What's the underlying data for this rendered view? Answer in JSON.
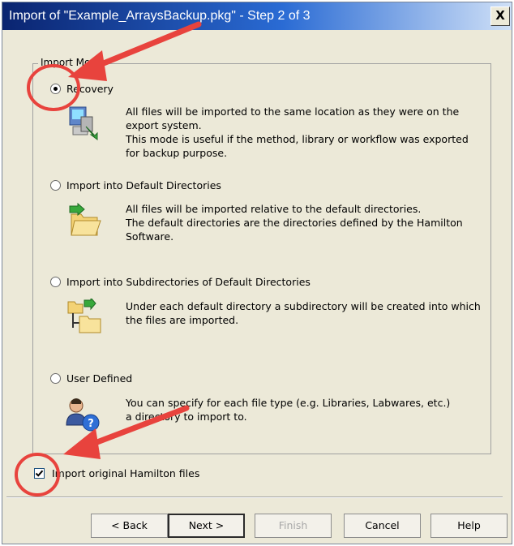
{
  "window": {
    "title": "Import of \"Example_ArraysBackup.pkg\" - Step 2 of 3",
    "close_label": "X"
  },
  "import_mode": {
    "legend": "Import Mod",
    "options": [
      {
        "label": "Recovery",
        "checked": true,
        "icon": "computer-arrow-icon",
        "description": [
          "All files will be imported to the same location as they were on the",
          "export system.",
          "This mode is useful if the method, library or workflow was exported",
          "for backup purpose."
        ]
      },
      {
        "label": "Import into Default Directories",
        "checked": false,
        "icon": "folder-arrow-icon",
        "description": [
          "All files will be imported relative to the default directories.",
          "The default directories are the directories defined by the Hamilton",
          "Software."
        ]
      },
      {
        "label": "Import into Subdirectories of Default Directories",
        "checked": false,
        "icon": "folder-tree-icon",
        "description": [
          "Under each default directory a subdirectory will be created into which",
          "the files are imported."
        ]
      },
      {
        "label": "User Defined",
        "checked": false,
        "icon": "user-question-icon",
        "description": [
          "You can specify for each file type (e.g. Libraries, Labwares, etc.)",
          "a directory to import to."
        ]
      }
    ]
  },
  "import_original": {
    "label": "Import original Hamilton files",
    "checked": true
  },
  "buttons": {
    "back": "< Back",
    "next": "Next >",
    "finish": "Finish",
    "cancel": "Cancel",
    "help": "Help"
  },
  "colors": {
    "annotation_red": "#e8433d",
    "titlebar_start": "#0a2470",
    "dialog_bg": "#ece9d8"
  }
}
